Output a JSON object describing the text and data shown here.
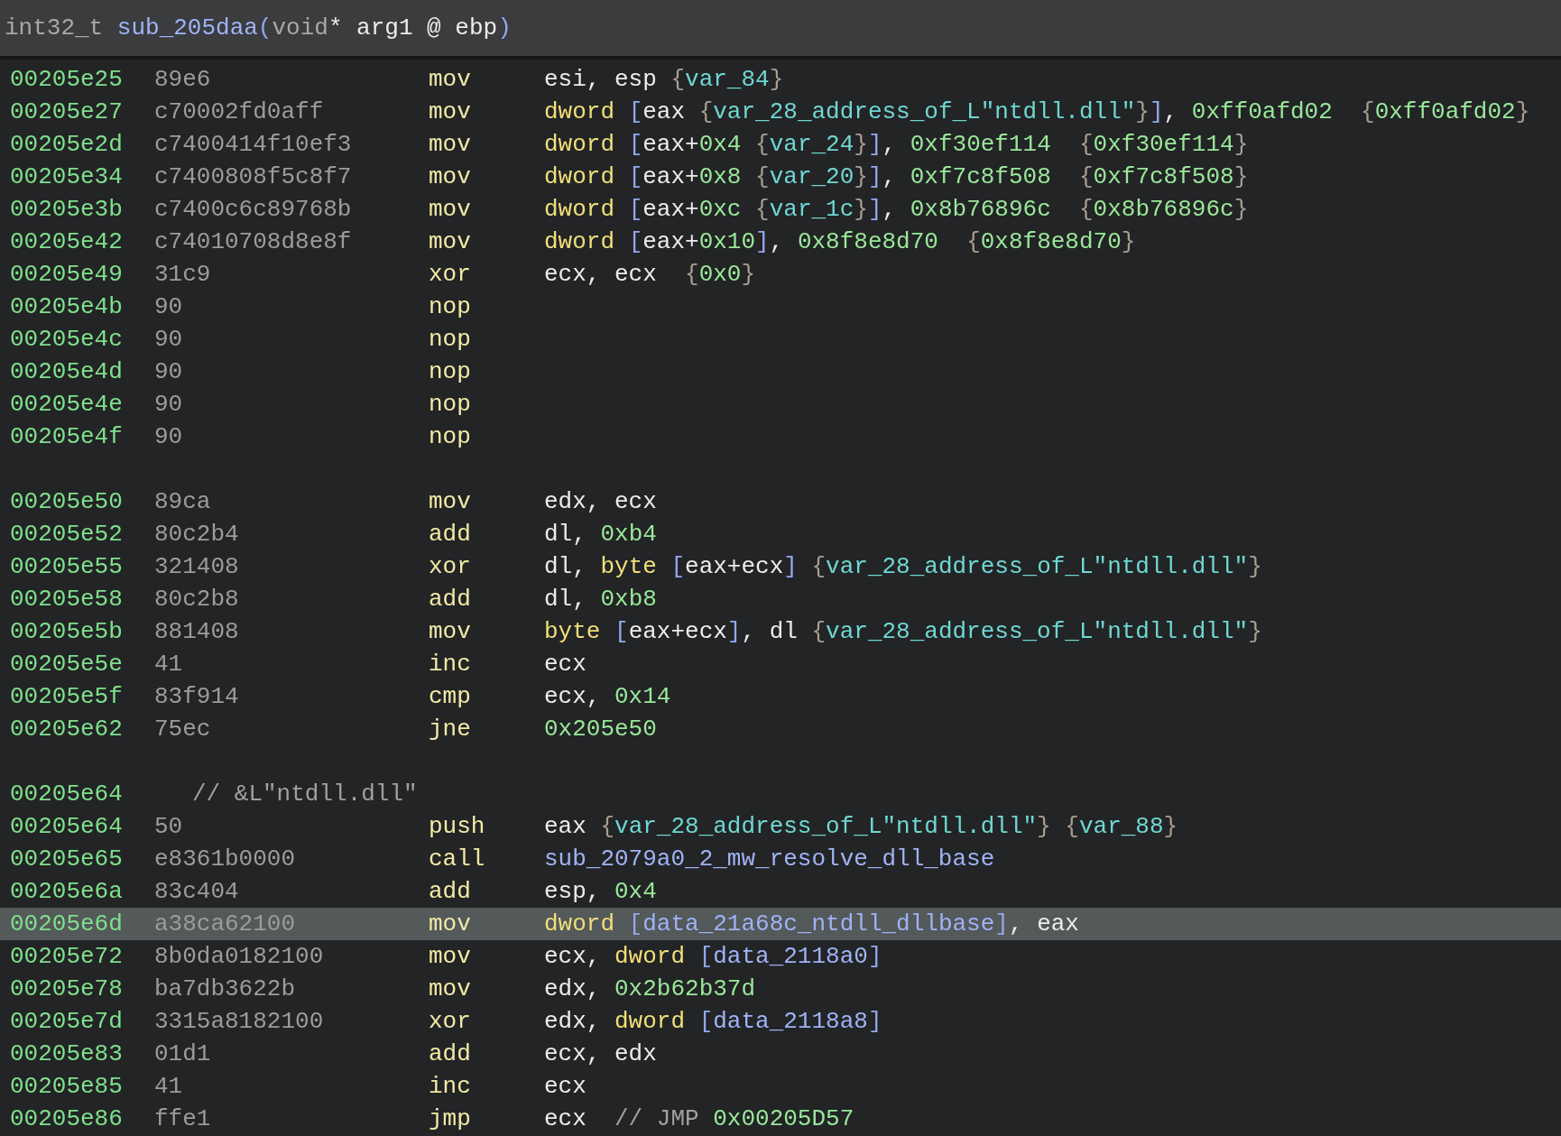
{
  "header": {
    "signature": [
      {
        "kind": "type",
        "text": "int32_t "
      },
      {
        "kind": "sym",
        "text": "sub_205daa"
      },
      {
        "kind": "brk",
        "text": "("
      },
      {
        "kind": "type",
        "text": "void"
      },
      {
        "kind": "plain",
        "text": "* arg1 @ ebp"
      },
      {
        "kind": "brk",
        "text": ")"
      }
    ]
  },
  "rows": [
    {
      "kind": "instr",
      "selected": false,
      "address": "00205e25",
      "bytes": "89e6",
      "mnemonic": "mov",
      "operands": [
        {
          "kind": "plain",
          "text": "esi, esp "
        },
        {
          "kind": "brc",
          "text": "{"
        },
        {
          "kind": "var",
          "text": "var_84"
        },
        {
          "kind": "brc",
          "text": "}"
        }
      ]
    },
    {
      "kind": "instr",
      "selected": false,
      "address": "00205e27",
      "bytes": "c70002fd0aff",
      "mnemonic": "mov",
      "operands": [
        {
          "kind": "kw",
          "text": "dword "
        },
        {
          "kind": "brk",
          "text": "["
        },
        {
          "kind": "plain",
          "text": "eax "
        },
        {
          "kind": "brc",
          "text": "{"
        },
        {
          "kind": "var",
          "text": "var_28_address_of_L\"ntdll.dll\""
        },
        {
          "kind": "brc",
          "text": "}"
        },
        {
          "kind": "brk",
          "text": "]"
        },
        {
          "kind": "plain",
          "text": ", "
        },
        {
          "kind": "num",
          "text": "0xff0afd02  "
        },
        {
          "kind": "brc",
          "text": "{"
        },
        {
          "kind": "num",
          "text": "0xff0afd02"
        },
        {
          "kind": "brc",
          "text": "}"
        }
      ]
    },
    {
      "kind": "instr",
      "selected": false,
      "address": "00205e2d",
      "bytes": "c7400414f10ef3",
      "mnemonic": "mov",
      "operands": [
        {
          "kind": "kw",
          "text": "dword "
        },
        {
          "kind": "brk",
          "text": "["
        },
        {
          "kind": "plain",
          "text": "eax+"
        },
        {
          "kind": "num",
          "text": "0x4 "
        },
        {
          "kind": "brc",
          "text": "{"
        },
        {
          "kind": "var",
          "text": "var_24"
        },
        {
          "kind": "brc",
          "text": "}"
        },
        {
          "kind": "brk",
          "text": "]"
        },
        {
          "kind": "plain",
          "text": ", "
        },
        {
          "kind": "num",
          "text": "0xf30ef114  "
        },
        {
          "kind": "brc",
          "text": "{"
        },
        {
          "kind": "num",
          "text": "0xf30ef114"
        },
        {
          "kind": "brc",
          "text": "}"
        }
      ]
    },
    {
      "kind": "instr",
      "selected": false,
      "address": "00205e34",
      "bytes": "c7400808f5c8f7",
      "mnemonic": "mov",
      "operands": [
        {
          "kind": "kw",
          "text": "dword "
        },
        {
          "kind": "brk",
          "text": "["
        },
        {
          "kind": "plain",
          "text": "eax+"
        },
        {
          "kind": "num",
          "text": "0x8 "
        },
        {
          "kind": "brc",
          "text": "{"
        },
        {
          "kind": "var",
          "text": "var_20"
        },
        {
          "kind": "brc",
          "text": "}"
        },
        {
          "kind": "brk",
          "text": "]"
        },
        {
          "kind": "plain",
          "text": ", "
        },
        {
          "kind": "num",
          "text": "0xf7c8f508  "
        },
        {
          "kind": "brc",
          "text": "{"
        },
        {
          "kind": "num",
          "text": "0xf7c8f508"
        },
        {
          "kind": "brc",
          "text": "}"
        }
      ]
    },
    {
      "kind": "instr",
      "selected": false,
      "address": "00205e3b",
      "bytes": "c7400c6c89768b",
      "mnemonic": "mov",
      "operands": [
        {
          "kind": "kw",
          "text": "dword "
        },
        {
          "kind": "brk",
          "text": "["
        },
        {
          "kind": "plain",
          "text": "eax+"
        },
        {
          "kind": "num",
          "text": "0xc "
        },
        {
          "kind": "brc",
          "text": "{"
        },
        {
          "kind": "var",
          "text": "var_1c"
        },
        {
          "kind": "brc",
          "text": "}"
        },
        {
          "kind": "brk",
          "text": "]"
        },
        {
          "kind": "plain",
          "text": ", "
        },
        {
          "kind": "num",
          "text": "0x8b76896c  "
        },
        {
          "kind": "brc",
          "text": "{"
        },
        {
          "kind": "num",
          "text": "0x8b76896c"
        },
        {
          "kind": "brc",
          "text": "}"
        }
      ]
    },
    {
      "kind": "instr",
      "selected": false,
      "address": "00205e42",
      "bytes": "c74010708d8e8f",
      "mnemonic": "mov",
      "operands": [
        {
          "kind": "kw",
          "text": "dword "
        },
        {
          "kind": "brk",
          "text": "["
        },
        {
          "kind": "plain",
          "text": "eax+"
        },
        {
          "kind": "num",
          "text": "0x10"
        },
        {
          "kind": "brk",
          "text": "]"
        },
        {
          "kind": "plain",
          "text": ", "
        },
        {
          "kind": "num",
          "text": "0x8f8e8d70  "
        },
        {
          "kind": "brc",
          "text": "{"
        },
        {
          "kind": "num",
          "text": "0x8f8e8d70"
        },
        {
          "kind": "brc",
          "text": "}"
        }
      ]
    },
    {
      "kind": "instr",
      "selected": false,
      "address": "00205e49",
      "bytes": "31c9",
      "mnemonic": "xor",
      "operands": [
        {
          "kind": "plain",
          "text": "ecx, ecx  "
        },
        {
          "kind": "brc",
          "text": "{"
        },
        {
          "kind": "num",
          "text": "0x0"
        },
        {
          "kind": "brc",
          "text": "}"
        }
      ]
    },
    {
      "kind": "instr",
      "selected": false,
      "address": "00205e4b",
      "bytes": "90",
      "mnemonic": "nop"
    },
    {
      "kind": "instr",
      "selected": false,
      "address": "00205e4c",
      "bytes": "90",
      "mnemonic": "nop"
    },
    {
      "kind": "instr",
      "selected": false,
      "address": "00205e4d",
      "bytes": "90",
      "mnemonic": "nop"
    },
    {
      "kind": "instr",
      "selected": false,
      "address": "00205e4e",
      "bytes": "90",
      "mnemonic": "nop"
    },
    {
      "kind": "instr",
      "selected": false,
      "address": "00205e4f",
      "bytes": "90",
      "mnemonic": "nop"
    },
    {
      "kind": "blank",
      "selected": false
    },
    {
      "kind": "instr",
      "selected": false,
      "address": "00205e50",
      "bytes": "89ca",
      "mnemonic": "mov",
      "operands": [
        {
          "kind": "plain",
          "text": "edx, ecx"
        }
      ]
    },
    {
      "kind": "instr",
      "selected": false,
      "address": "00205e52",
      "bytes": "80c2b4",
      "mnemonic": "add",
      "operands": [
        {
          "kind": "plain",
          "text": "dl, "
        },
        {
          "kind": "num",
          "text": "0xb4"
        }
      ]
    },
    {
      "kind": "instr",
      "selected": false,
      "address": "00205e55",
      "bytes": "321408",
      "mnemonic": "xor",
      "operands": [
        {
          "kind": "plain",
          "text": "dl, "
        },
        {
          "kind": "kw",
          "text": "byte "
        },
        {
          "kind": "brk",
          "text": "["
        },
        {
          "kind": "plain",
          "text": "eax+ecx"
        },
        {
          "kind": "brk",
          "text": "] "
        },
        {
          "kind": "brc",
          "text": "{"
        },
        {
          "kind": "var",
          "text": "var_28_address_of_L\"ntdll.dll\""
        },
        {
          "kind": "brc",
          "text": "}"
        }
      ]
    },
    {
      "kind": "instr",
      "selected": false,
      "address": "00205e58",
      "bytes": "80c2b8",
      "mnemonic": "add",
      "operands": [
        {
          "kind": "plain",
          "text": "dl, "
        },
        {
          "kind": "num",
          "text": "0xb8"
        }
      ]
    },
    {
      "kind": "instr",
      "selected": false,
      "address": "00205e5b",
      "bytes": "881408",
      "mnemonic": "mov",
      "operands": [
        {
          "kind": "kw",
          "text": "byte "
        },
        {
          "kind": "brk",
          "text": "["
        },
        {
          "kind": "plain",
          "text": "eax+ecx"
        },
        {
          "kind": "brk",
          "text": "]"
        },
        {
          "kind": "plain",
          "text": ", dl "
        },
        {
          "kind": "brc",
          "text": "{"
        },
        {
          "kind": "var",
          "text": "var_28_address_of_L\"ntdll.dll\""
        },
        {
          "kind": "brc",
          "text": "}"
        }
      ]
    },
    {
      "kind": "instr",
      "selected": false,
      "address": "00205e5e",
      "bytes": "41",
      "mnemonic": "inc",
      "operands": [
        {
          "kind": "plain",
          "text": "ecx"
        }
      ]
    },
    {
      "kind": "instr",
      "selected": false,
      "address": "00205e5f",
      "bytes": "83f914",
      "mnemonic": "cmp",
      "operands": [
        {
          "kind": "plain",
          "text": "ecx, "
        },
        {
          "kind": "num",
          "text": "0x14"
        }
      ]
    },
    {
      "kind": "instr",
      "selected": false,
      "address": "00205e62",
      "bytes": "75ec",
      "mnemonic": "jne",
      "operands": [
        {
          "kind": "num",
          "text": "0x205e50"
        }
      ]
    },
    {
      "kind": "blank",
      "selected": false
    },
    {
      "kind": "comment",
      "selected": false,
      "address": "00205e64",
      "comment": "// &L\"ntdll.dll\""
    },
    {
      "kind": "instr",
      "selected": false,
      "address": "00205e64",
      "bytes": "50",
      "mnemonic": "push",
      "operands": [
        {
          "kind": "plain",
          "text": "eax "
        },
        {
          "kind": "brc",
          "text": "{"
        },
        {
          "kind": "var",
          "text": "var_28_address_of_L\"ntdll.dll\""
        },
        {
          "kind": "brc",
          "text": "} {"
        },
        {
          "kind": "var",
          "text": "var_88"
        },
        {
          "kind": "brc",
          "text": "}"
        }
      ]
    },
    {
      "kind": "instr",
      "selected": false,
      "address": "00205e65",
      "bytes": "e8361b0000",
      "mnemonic": "call",
      "operands": [
        {
          "kind": "sym",
          "text": "sub_2079a0_2_mw_resolve_dll_base"
        }
      ]
    },
    {
      "kind": "instr",
      "selected": false,
      "address": "00205e6a",
      "bytes": "83c404",
      "mnemonic": "add",
      "operands": [
        {
          "kind": "plain",
          "text": "esp, "
        },
        {
          "kind": "num",
          "text": "0x4"
        }
      ]
    },
    {
      "kind": "instr",
      "selected": true,
      "address": "00205e6d",
      "bytes": "a38ca62100",
      "mnemonic": "mov",
      "operands": [
        {
          "kind": "kw",
          "text": "dword "
        },
        {
          "kind": "brk",
          "text": "["
        },
        {
          "kind": "sym",
          "text": "data_21a68c_ntdll_dllbase"
        },
        {
          "kind": "brk",
          "text": "]"
        },
        {
          "kind": "plain",
          "text": ", eax"
        }
      ]
    },
    {
      "kind": "instr",
      "selected": false,
      "address": "00205e72",
      "bytes": "8b0da0182100",
      "mnemonic": "mov",
      "operands": [
        {
          "kind": "plain",
          "text": "ecx, "
        },
        {
          "kind": "kw",
          "text": "dword "
        },
        {
          "kind": "brk",
          "text": "["
        },
        {
          "kind": "sym",
          "text": "data_2118a0"
        },
        {
          "kind": "brk",
          "text": "]"
        }
      ]
    },
    {
      "kind": "instr",
      "selected": false,
      "address": "00205e78",
      "bytes": "ba7db3622b",
      "mnemonic": "mov",
      "operands": [
        {
          "kind": "plain",
          "text": "edx, "
        },
        {
          "kind": "num",
          "text": "0x2b62b37d"
        }
      ]
    },
    {
      "kind": "instr",
      "selected": false,
      "address": "00205e7d",
      "bytes": "3315a8182100",
      "mnemonic": "xor",
      "operands": [
        {
          "kind": "plain",
          "text": "edx, "
        },
        {
          "kind": "kw",
          "text": "dword "
        },
        {
          "kind": "brk",
          "text": "["
        },
        {
          "kind": "sym",
          "text": "data_2118a8"
        },
        {
          "kind": "brk",
          "text": "]"
        }
      ]
    },
    {
      "kind": "instr",
      "selected": false,
      "address": "00205e83",
      "bytes": "01d1",
      "mnemonic": "add",
      "operands": [
        {
          "kind": "plain",
          "text": "ecx, edx"
        }
      ]
    },
    {
      "kind": "instr",
      "selected": false,
      "address": "00205e85",
      "bytes": "41",
      "mnemonic": "inc",
      "operands": [
        {
          "kind": "plain",
          "text": "ecx"
        }
      ]
    },
    {
      "kind": "instr",
      "selected": false,
      "address": "00205e86",
      "bytes": "ffe1",
      "mnemonic": "jmp",
      "operands": [
        {
          "kind": "plain",
          "text": "ecx  "
        },
        {
          "kind": "cmt",
          "text": "// JMP "
        },
        {
          "kind": "num",
          "text": "0x00205D57"
        }
      ]
    }
  ]
}
